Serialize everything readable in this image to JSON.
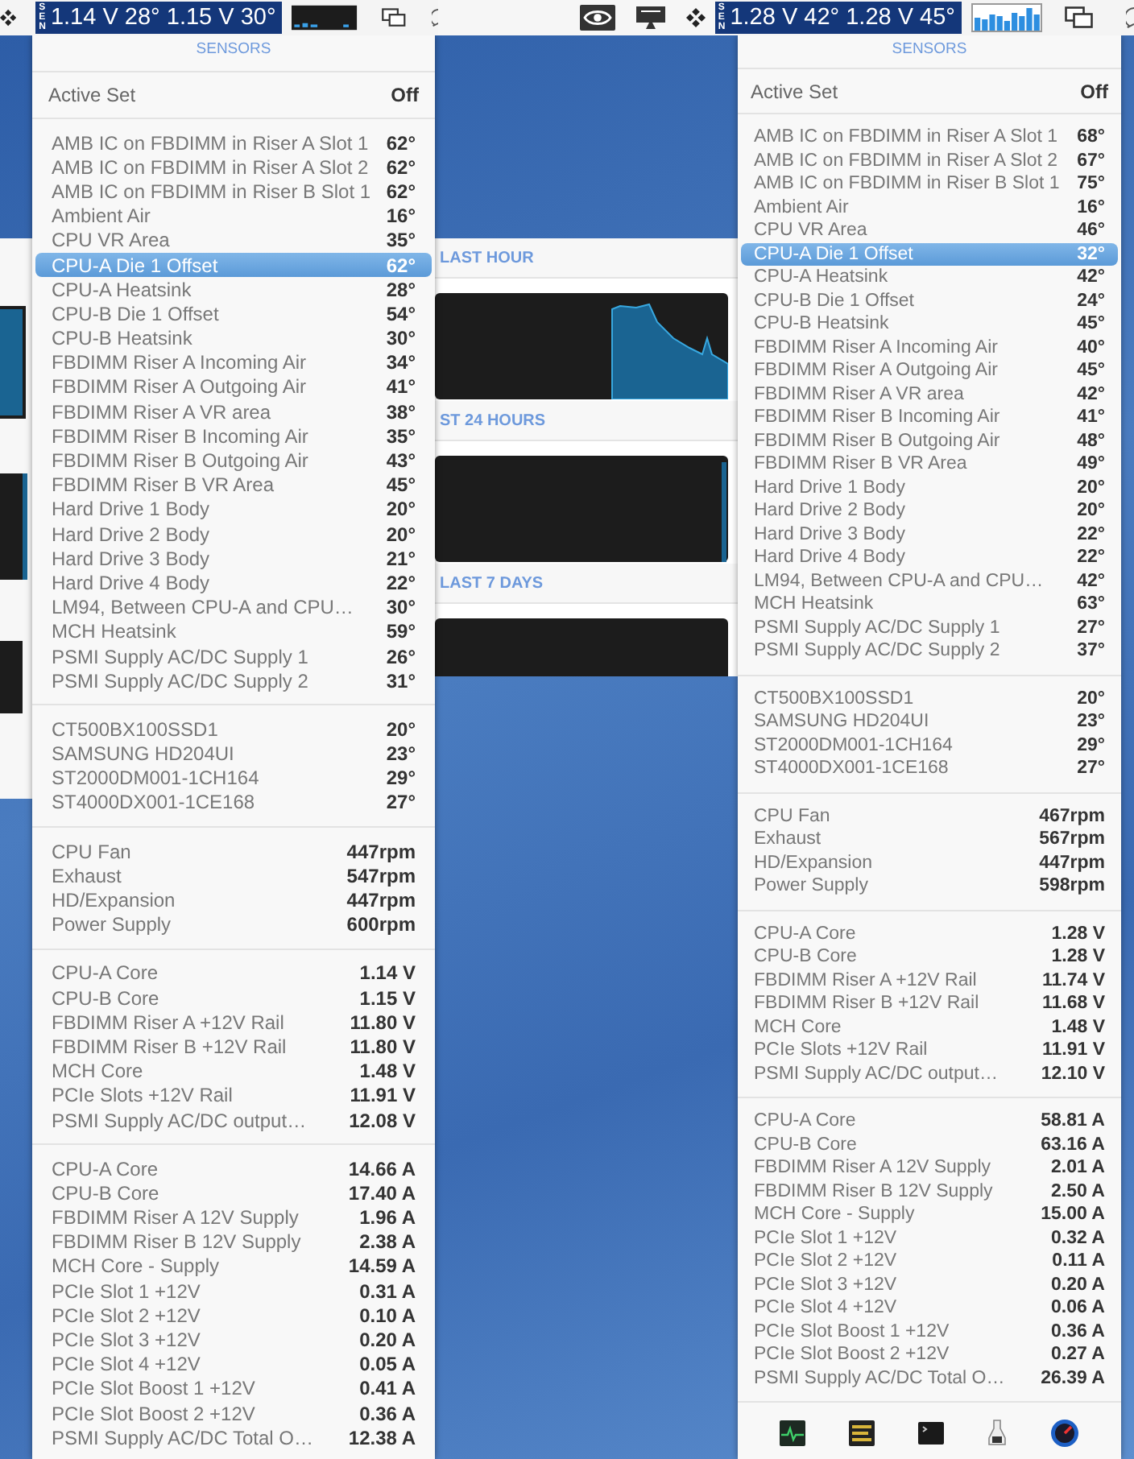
{
  "menu_bars": [
    {
      "badge": "SEN",
      "reading": "1.14 V 28° 1.15 V 30°"
    },
    {
      "badge": "SEN",
      "reading": "1.28 V 42° 1.28 V 45°"
    }
  ],
  "history_window": {
    "sections": [
      {
        "label": "LAST HOUR"
      },
      {
        "label": "ST 24 HOURS"
      },
      {
        "label": "LAST 7 DAYS"
      }
    ]
  },
  "panels": [
    {
      "title": "SENSORS",
      "active_set": {
        "label": "Active Set",
        "value": "Off"
      },
      "toolbar": false,
      "groups": [
        {
          "rows": [
            {
              "name": "AMB IC on FBDIMM in Riser A Slot 1",
              "value": "62°",
              "selected": false
            },
            {
              "name": "AMB IC on FBDIMM in Riser A Slot 2",
              "value": "62°",
              "selected": false
            },
            {
              "name": "AMB IC on FBDIMM in Riser B Slot 1",
              "value": "62°",
              "selected": false
            },
            {
              "name": "Ambient Air",
              "value": "16°",
              "selected": false
            },
            {
              "name": "CPU VR Area",
              "value": "35°",
              "selected": false
            },
            {
              "name": "CPU-A Die 1 Offset",
              "value": "62°",
              "selected": true
            },
            {
              "name": "CPU-A Heatsink",
              "value": "28°",
              "selected": false
            },
            {
              "name": "CPU-B Die 1 Offset",
              "value": "54°",
              "selected": false
            },
            {
              "name": "CPU-B Heatsink",
              "value": "30°",
              "selected": false
            },
            {
              "name": "FBDIMM Riser A Incoming Air",
              "value": "34°",
              "selected": false
            },
            {
              "name": "FBDIMM Riser A Outgoing Air",
              "value": "41°",
              "selected": false
            },
            {
              "name": "FBDIMM Riser A VR area",
              "value": "38°",
              "selected": false
            },
            {
              "name": "FBDIMM Riser B Incoming Air",
              "value": "35°",
              "selected": false
            },
            {
              "name": "FBDIMM Riser B Outgoing Air",
              "value": "43°",
              "selected": false
            },
            {
              "name": "FBDIMM Riser B VR Area",
              "value": "45°",
              "selected": false
            },
            {
              "name": "Hard Drive 1 Body",
              "value": "20°",
              "selected": false
            },
            {
              "name": "Hard Drive 2 Body",
              "value": "20°",
              "selected": false
            },
            {
              "name": "Hard Drive 3 Body",
              "value": "21°",
              "selected": false
            },
            {
              "name": "Hard Drive 4 Body",
              "value": "22°",
              "selected": false
            },
            {
              "name": "LM94, Between CPU-A and CPU…",
              "value": "30°",
              "selected": false
            },
            {
              "name": "MCH Heatsink",
              "value": "59°",
              "selected": false
            },
            {
              "name": "PSMI Supply AC/DC Supply 1",
              "value": "26°",
              "selected": false
            },
            {
              "name": "PSMI Supply AC/DC Supply 2",
              "value": "31°",
              "selected": false
            }
          ]
        },
        {
          "rows": [
            {
              "name": "CT500BX100SSD1",
              "value": "20°",
              "selected": false
            },
            {
              "name": "SAMSUNG HD204UI",
              "value": "23°",
              "selected": false
            },
            {
              "name": "ST2000DM001-1CH164",
              "value": "29°",
              "selected": false
            },
            {
              "name": "ST4000DX001-1CE168",
              "value": "27°",
              "selected": false
            }
          ]
        },
        {
          "rows": [
            {
              "name": "CPU Fan",
              "value": "447rpm",
              "selected": false
            },
            {
              "name": "Exhaust",
              "value": "547rpm",
              "selected": false
            },
            {
              "name": "HD/Expansion",
              "value": "447rpm",
              "selected": false
            },
            {
              "name": "Power Supply",
              "value": "600rpm",
              "selected": false
            }
          ]
        },
        {
          "rows": [
            {
              "name": "CPU-A Core",
              "value": "1.14 V",
              "selected": false
            },
            {
              "name": "CPU-B Core",
              "value": "1.15 V",
              "selected": false
            },
            {
              "name": "FBDIMM Riser A +12V Rail",
              "value": "11.80 V",
              "selected": false
            },
            {
              "name": "FBDIMM Riser B +12V Rail",
              "value": "11.80 V",
              "selected": false
            },
            {
              "name": "MCH Core",
              "value": "1.48 V",
              "selected": false
            },
            {
              "name": "PCIe Slots +12V Rail",
              "value": "11.91 V",
              "selected": false
            },
            {
              "name": "PSMI Supply AC/DC output…",
              "value": "12.08 V",
              "selected": false
            }
          ]
        },
        {
          "rows": [
            {
              "name": "CPU-A Core",
              "value": "14.66 A",
              "selected": false
            },
            {
              "name": "CPU-B Core",
              "value": "17.40 A",
              "selected": false
            },
            {
              "name": "FBDIMM Riser A 12V Supply",
              "value": "1.96 A",
              "selected": false
            },
            {
              "name": "FBDIMM Riser B 12V Supply",
              "value": "2.38 A",
              "selected": false
            },
            {
              "name": "MCH Core - Supply",
              "value": "14.59 A",
              "selected": false
            },
            {
              "name": "PCIe Slot 1 +12V",
              "value": "0.31 A",
              "selected": false
            },
            {
              "name": "PCIe Slot 2 +12V",
              "value": "0.10 A",
              "selected": false
            },
            {
              "name": "PCIe Slot 3 +12V",
              "value": "0.20 A",
              "selected": false
            },
            {
              "name": "PCIe Slot 4 +12V",
              "value": "0.05 A",
              "selected": false
            },
            {
              "name": "PCIe Slot Boost 1 +12V",
              "value": "0.41 A",
              "selected": false
            },
            {
              "name": "PCIe Slot Boost 2 +12V",
              "value": "0.36 A",
              "selected": false
            },
            {
              "name": "PSMI Supply AC/DC Total O…",
              "value": "12.38 A",
              "selected": false
            }
          ]
        }
      ]
    },
    {
      "title": "SENSORS",
      "active_set": {
        "label": "Active Set",
        "value": "Off"
      },
      "toolbar": true,
      "groups": [
        {
          "rows": [
            {
              "name": "AMB IC on FBDIMM in Riser A Slot 1",
              "value": "68°",
              "selected": false
            },
            {
              "name": "AMB IC on FBDIMM in Riser A Slot 2",
              "value": "67°",
              "selected": false
            },
            {
              "name": "AMB IC on FBDIMM in Riser B Slot 1",
              "value": "75°",
              "selected": false
            },
            {
              "name": "Ambient Air",
              "value": "16°",
              "selected": false
            },
            {
              "name": "CPU VR Area",
              "value": "46°",
              "selected": false
            },
            {
              "name": "CPU-A Die 1 Offset",
              "value": "32°",
              "selected": true
            },
            {
              "name": "CPU-A Heatsink",
              "value": "42°",
              "selected": false
            },
            {
              "name": "CPU-B Die 1 Offset",
              "value": "24°",
              "selected": false
            },
            {
              "name": "CPU-B Heatsink",
              "value": "45°",
              "selected": false
            },
            {
              "name": "FBDIMM Riser A Incoming Air",
              "value": "40°",
              "selected": false
            },
            {
              "name": "FBDIMM Riser A Outgoing Air",
              "value": "45°",
              "selected": false
            },
            {
              "name": "FBDIMM Riser A VR area",
              "value": "42°",
              "selected": false
            },
            {
              "name": "FBDIMM Riser B Incoming Air",
              "value": "41°",
              "selected": false
            },
            {
              "name": "FBDIMM Riser B Outgoing Air",
              "value": "48°",
              "selected": false
            },
            {
              "name": "FBDIMM Riser B VR Area",
              "value": "49°",
              "selected": false
            },
            {
              "name": "Hard Drive 1 Body",
              "value": "20°",
              "selected": false
            },
            {
              "name": "Hard Drive 2 Body",
              "value": "20°",
              "selected": false
            },
            {
              "name": "Hard Drive 3 Body",
              "value": "22°",
              "selected": false
            },
            {
              "name": "Hard Drive 4 Body",
              "value": "22°",
              "selected": false
            },
            {
              "name": "LM94, Between CPU-A and CPU…",
              "value": "42°",
              "selected": false
            },
            {
              "name": "MCH Heatsink",
              "value": "63°",
              "selected": false
            },
            {
              "name": "PSMI Supply AC/DC Supply 1",
              "value": "27°",
              "selected": false
            },
            {
              "name": "PSMI Supply AC/DC Supply 2",
              "value": "37°",
              "selected": false
            }
          ]
        },
        {
          "rows": [
            {
              "name": "CT500BX100SSD1",
              "value": "20°",
              "selected": false
            },
            {
              "name": "SAMSUNG HD204UI",
              "value": "23°",
              "selected": false
            },
            {
              "name": "ST2000DM001-1CH164",
              "value": "29°",
              "selected": false
            },
            {
              "name": "ST4000DX001-1CE168",
              "value": "27°",
              "selected": false
            }
          ]
        },
        {
          "rows": [
            {
              "name": "CPU Fan",
              "value": "467rpm",
              "selected": false
            },
            {
              "name": "Exhaust",
              "value": "567rpm",
              "selected": false
            },
            {
              "name": "HD/Expansion",
              "value": "447rpm",
              "selected": false
            },
            {
              "name": "Power Supply",
              "value": "598rpm",
              "selected": false
            }
          ]
        },
        {
          "rows": [
            {
              "name": "CPU-A Core",
              "value": "1.28 V",
              "selected": false
            },
            {
              "name": "CPU-B Core",
              "value": "1.28 V",
              "selected": false
            },
            {
              "name": "FBDIMM Riser A +12V Rail",
              "value": "11.74 V",
              "selected": false
            },
            {
              "name": "FBDIMM Riser B +12V Rail",
              "value": "11.68 V",
              "selected": false
            },
            {
              "name": "MCH Core",
              "value": "1.48 V",
              "selected": false
            },
            {
              "name": "PCIe Slots +12V Rail",
              "value": "11.91 V",
              "selected": false
            },
            {
              "name": "PSMI Supply AC/DC output…",
              "value": "12.10 V",
              "selected": false
            }
          ]
        },
        {
          "rows": [
            {
              "name": "CPU-A Core",
              "value": "58.81 A",
              "selected": false
            },
            {
              "name": "CPU-B Core",
              "value": "63.16 A",
              "selected": false
            },
            {
              "name": "FBDIMM Riser A 12V Supply",
              "value": "2.01 A",
              "selected": false
            },
            {
              "name": "FBDIMM Riser B 12V Supply",
              "value": "2.50 A",
              "selected": false
            },
            {
              "name": "MCH Core - Supply",
              "value": "15.00 A",
              "selected": false
            },
            {
              "name": "PCIe Slot 1 +12V",
              "value": "0.32 A",
              "selected": false
            },
            {
              "name": "PCIe Slot 2 +12V",
              "value": "0.11 A",
              "selected": false
            },
            {
              "name": "PCIe Slot 3 +12V",
              "value": "0.20 A",
              "selected": false
            },
            {
              "name": "PCIe Slot 4 +12V",
              "value": "0.06 A",
              "selected": false
            },
            {
              "name": "PCIe Slot Boost 1 +12V",
              "value": "0.36 A",
              "selected": false
            },
            {
              "name": "PCIe Slot Boost 2 +12V",
              "value": "0.27 A",
              "selected": false
            },
            {
              "name": "PSMI Supply AC/DC Total O…",
              "value": "26.39 A",
              "selected": false
            }
          ]
        }
      ]
    }
  ]
}
